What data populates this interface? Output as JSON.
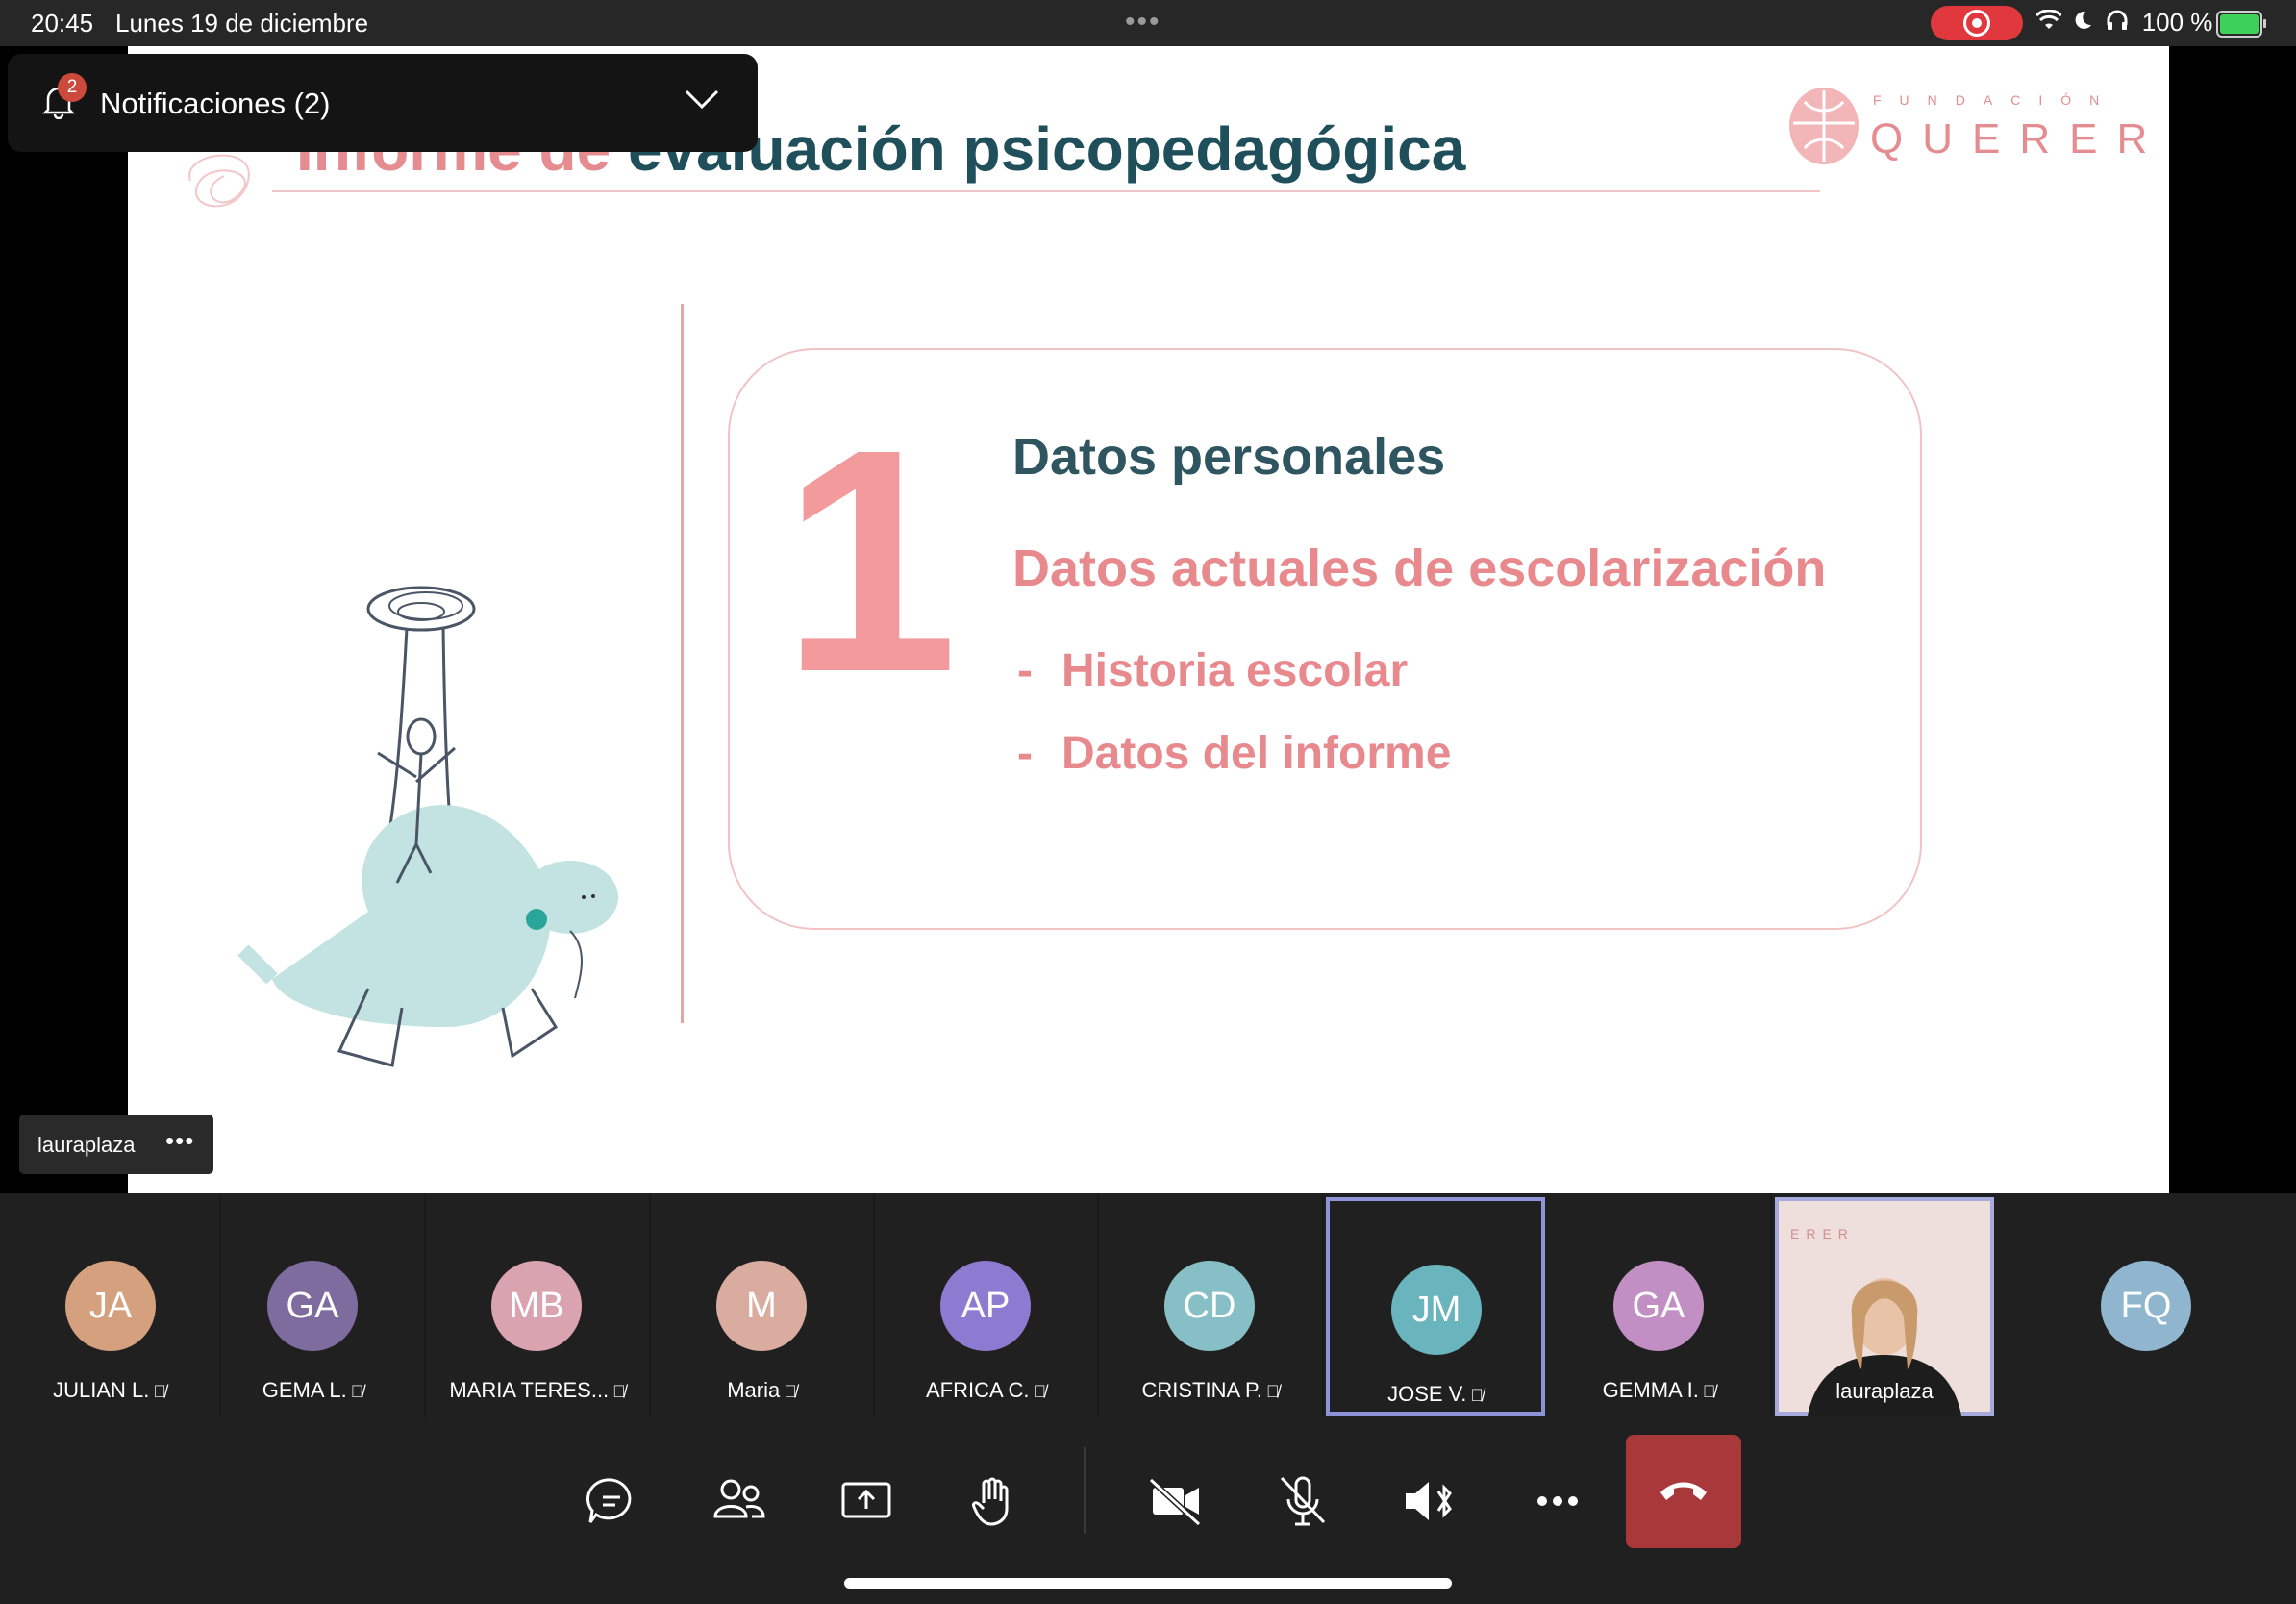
{
  "status_bar": {
    "time": "20:45",
    "date": "Lunes 19 de diciembre",
    "battery": "100 %"
  },
  "notification": {
    "count_badge": "2",
    "label": "Notificaciones (2)"
  },
  "slide": {
    "title_pink": "Informe de ",
    "title_dark": "evaluación psicopedagógica",
    "brand_small": "FUNDACIÓN",
    "brand_big": "QUERER",
    "number": "1",
    "item1": "Datos personales",
    "item2": "Datos actuales de escolarización",
    "sub_dash": "-",
    "sub1": "Historia escolar",
    "sub2": "Datos del informe"
  },
  "presenter": {
    "name": "lauraplaza",
    "more": "•••"
  },
  "participants": [
    {
      "initials": "JA",
      "name": "JULIAN L.",
      "color": "#d4a07e"
    },
    {
      "initials": "GA",
      "name": "GEMA L.",
      "color": "#7e6c9f"
    },
    {
      "initials": "MB",
      "name": "MARIA TERES...",
      "color": "#d9a3b0"
    },
    {
      "initials": "M",
      "name": "Maria",
      "color": "#d9ac9f"
    },
    {
      "initials": "AP",
      "name": "AFRICA C.",
      "color": "#8d7bd1"
    },
    {
      "initials": "CD",
      "name": "CRISTINA P.",
      "color": "#86c0c6"
    },
    {
      "initials": "JM",
      "name": "JOSE V.",
      "color": "#6ab4be"
    },
    {
      "initials": "GA",
      "name": "GEMMA I.",
      "color": "#c18fc3"
    },
    {
      "initials": "",
      "name": "lauraplaza",
      "color": "#eedfdc",
      "video_brand": "ERER"
    },
    {
      "initials": "FQ",
      "name": "",
      "color": "#8fb5cf"
    }
  ],
  "toolbar": {
    "chat": "chat-icon",
    "people": "people-icon",
    "share": "share-screen-icon",
    "raise_hand": "raise-hand-icon",
    "camera": "camera-off-icon",
    "mic": "mic-off-icon",
    "speaker": "speaker-bluetooth-icon",
    "more": "more-icon",
    "hangup": "hangup-icon"
  }
}
